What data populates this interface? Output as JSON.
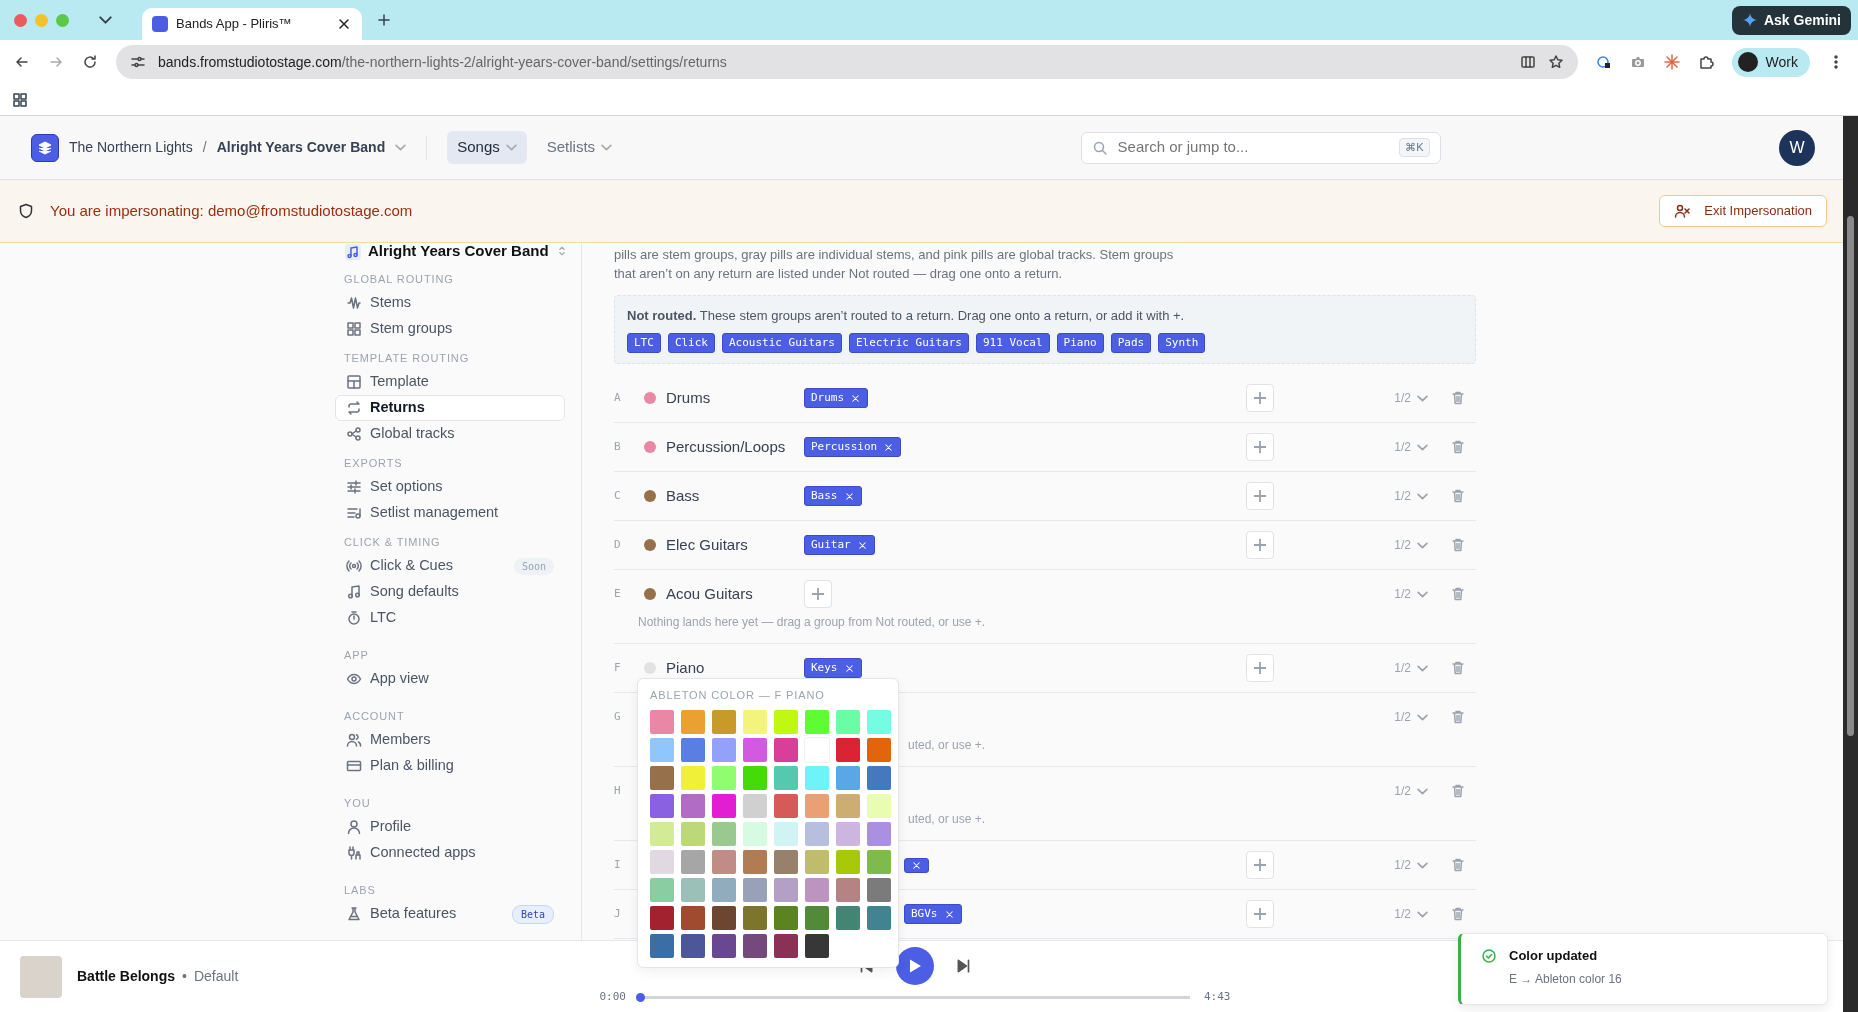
{
  "browser": {
    "tab_title": "Bands App - Pliris™",
    "url_host": "bands.fromstudiotostage.com",
    "url_path": "/the-northern-lights-2/alright-years-cover-band/settings/returns",
    "gemini": "Ask Gemini",
    "profile": "Work"
  },
  "header": {
    "org": "The Northern Lights",
    "separator": "/",
    "band": "Alright Years Cover Band",
    "tabs": [
      {
        "label": "Songs",
        "selected": true
      },
      {
        "label": "Setlists",
        "selected": false
      }
    ],
    "search_placeholder": "Search or jump to...",
    "shortcut": "⌘K",
    "avatar": "W"
  },
  "banner": {
    "text": "You are impersonating: demo@fromstudiotostage.com",
    "button": "Exit Impersonation"
  },
  "sidebar": {
    "band": "Alright Years Cover Band",
    "sections": [
      {
        "title": "GLOBAL ROUTING",
        "items": [
          {
            "label": "Stems",
            "selected": false
          },
          {
            "label": "Stem groups",
            "selected": false
          }
        ]
      },
      {
        "title": "TEMPLATE ROUTING",
        "items": [
          {
            "label": "Template",
            "selected": false
          },
          {
            "label": "Returns",
            "selected": true
          },
          {
            "label": "Global tracks",
            "selected": false
          }
        ]
      },
      {
        "title": "EXPORTS",
        "items": [
          {
            "label": "Set options",
            "selected": false
          },
          {
            "label": "Setlist management",
            "selected": false
          }
        ]
      },
      {
        "title": "CLICK & TIMING",
        "items": [
          {
            "label": "Click & Cues",
            "selected": false,
            "badge": "Soon"
          },
          {
            "label": "Song defaults",
            "selected": false
          },
          {
            "label": "LTC",
            "selected": false
          }
        ]
      },
      {
        "title": "APP",
        "items": [
          {
            "label": "App view",
            "selected": false
          }
        ]
      },
      {
        "title": "ACCOUNT",
        "items": [
          {
            "label": "Members",
            "selected": false
          },
          {
            "label": "Plan & billing",
            "selected": false
          }
        ]
      },
      {
        "title": "YOU",
        "items": [
          {
            "label": "Profile",
            "selected": false
          },
          {
            "label": "Connected apps",
            "selected": false
          }
        ]
      },
      {
        "title": "LABS",
        "items": [
          {
            "label": "Beta features",
            "selected": false,
            "badge": "Beta"
          }
        ]
      }
    ]
  },
  "intro": "pills are stem groups, gray pills are individual stems, and pink pills are global tracks. Stem groups that aren’t on any return are listed under Not routed — drag one onto a return.",
  "not_routed": {
    "text": "**Not routed.** These stem groups aren’t routed to a return. Drag one onto a return, or add it with +.",
    "pills": [
      "LTC",
      "Click",
      "Acoustic Guitars",
      "Electric Guitars",
      "911 Vocal",
      "Piano",
      "Pads",
      "Synth"
    ]
  },
  "returns": [
    {
      "letter": "A",
      "name": "Drums",
      "color": "#e987a5",
      "pills": [
        "Drums"
      ],
      "value": "1/2"
    },
    {
      "letter": "B",
      "name": "Percussion/Loops",
      "color": "#e987a5",
      "pills": [
        "Percussion"
      ],
      "value": "1/2"
    },
    {
      "letter": "C",
      "name": "Bass",
      "color": "#96704a",
      "pills": [
        "Bass"
      ],
      "value": "1/2"
    },
    {
      "letter": "D",
      "name": "Elec Guitars",
      "color": "#96704a",
      "pills": [
        "Guitar"
      ],
      "value": "1/2"
    },
    {
      "letter": "E",
      "name": "Acou Guitars",
      "color": "#96704a",
      "hint": "Nothing lands here yet — drag a group from Not routed, or use +.",
      "value": "1/2"
    },
    {
      "letter": "F",
      "name": "Piano",
      "color": "#e2e2e2",
      "pills": [
        "Keys"
      ],
      "value": "1/2"
    },
    {
      "letter": "G",
      "hint": "uted, or use +.",
      "value": "1/2"
    },
    {
      "letter": "H",
      "hint": "uted, or use +.",
      "value": "1/2"
    },
    {
      "letter": "I",
      "cut_pill": true,
      "value": "1/2"
    },
    {
      "letter": "J",
      "pills": [
        "BGVs"
      ],
      "value": "1/2"
    }
  ],
  "picker": {
    "title": "ABLETON COLOR — F PIANO",
    "swatches": [
      {
        "color": "#ea87a6"
      },
      {
        "color": "#e9a232"
      },
      {
        "color": "#c79a2a"
      },
      {
        "color": "#f2f47c"
      },
      {
        "color": "#bff812"
      },
      {
        "color": "#5efc32"
      },
      {
        "color": "#6bfda4"
      },
      {
        "color": "#75fde3"
      },
      {
        "color": "#8fc6fb"
      },
      {
        "color": "#587fe1"
      },
      {
        "color": "#93a1fb"
      },
      {
        "color": "#d15ae0"
      },
      {
        "color": "#d83f98"
      },
      {
        "color": "#ffffff"
      },
      {
        "color": "#dc2334"
      },
      {
        "color": "#e2650b"
      },
      {
        "color": "#96704a"
      },
      {
        "color": "#f0f039"
      },
      {
        "color": "#8ffd6d"
      },
      {
        "color": "#43dc08"
      },
      {
        "color": "#55c9af"
      },
      {
        "color": "#6ef3f8"
      },
      {
        "color": "#5ba6e6"
      },
      {
        "color": "#447abd"
      },
      {
        "color": "#8a61e0"
      },
      {
        "color": "#b16cc6"
      },
      {
        "color": "#e21ed2"
      },
      {
        "color": "#d0d0d0"
      },
      {
        "color": "#d65b58"
      },
      {
        "color": "#eb9f74"
      },
      {
        "color": "#cead72"
      },
      {
        "color": "#e9fdb1"
      },
      {
        "color": "#d3ea97"
      },
      {
        "color": "#bdd879"
      },
      {
        "color": "#99c98f"
      },
      {
        "color": "#d7fbe0"
      },
      {
        "color": "#d0f3f4"
      },
      {
        "color": "#b8bfde"
      },
      {
        "color": "#ccb6e0"
      },
      {
        "color": "#ab90e2"
      },
      {
        "color": "#e1d9e1"
      },
      {
        "color": "#a6a6a6"
      },
      {
        "color": "#c08c86"
      },
      {
        "color": "#b17b53"
      },
      {
        "color": "#98816a"
      },
      {
        "color": "#bfbd6b"
      },
      {
        "color": "#a6c806"
      },
      {
        "color": "#7fba4c"
      },
      {
        "color": "#8acda1"
      },
      {
        "color": "#9bc0b8"
      },
      {
        "color": "#91acbc"
      },
      {
        "color": "#99a1b8"
      },
      {
        "color": "#b4a0c4"
      },
      {
        "color": "#bd94c0"
      },
      {
        "color": "#b58384"
      },
      {
        "color": "#7b7b7b"
      },
      {
        "color": "#a2232f"
      },
      {
        "color": "#a04a2f"
      },
      {
        "color": "#6c4631"
      },
      {
        "color": "#7c762d"
      },
      {
        "color": "#5b8320"
      },
      {
        "color": "#528a3a"
      },
      {
        "color": "#428572"
      },
      {
        "color": "#418490"
      },
      {
        "color": "#3c6ea6"
      },
      {
        "color": "#4b5798"
      },
      {
        "color": "#6a4791"
      },
      {
        "color": "#744a7d"
      },
      {
        "color": "#8a3158"
      },
      {
        "color": "#373737"
      }
    ]
  },
  "player": {
    "song": "Battle Belongs",
    "dot": "•",
    "variant": "Default",
    "elapsed": "0:00",
    "total": "4:43",
    "level": 0.0
  },
  "toast": {
    "title": "Color updated",
    "detail": "E → Ableton color 16"
  }
}
